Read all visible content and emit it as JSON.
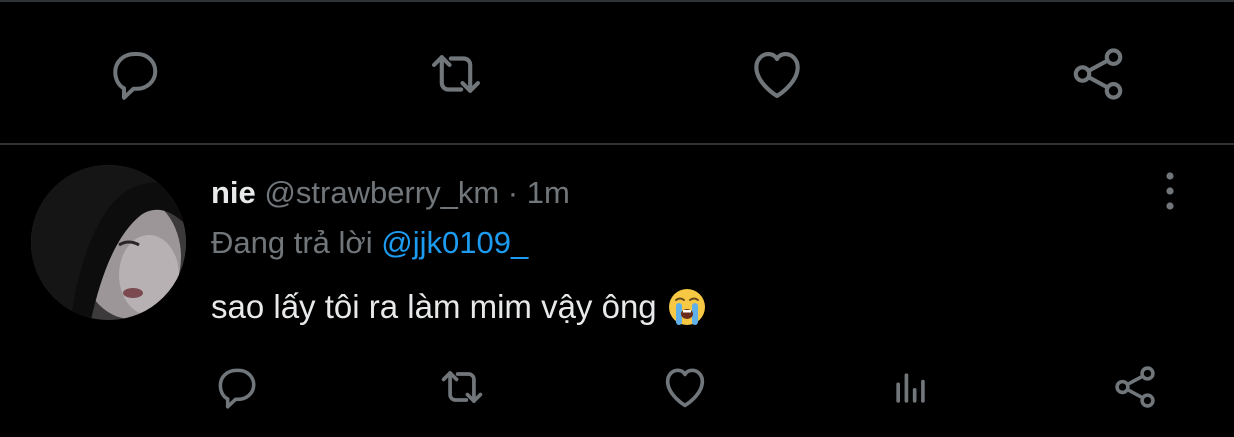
{
  "colors": {
    "background": "#000000",
    "divider": "#2f3336",
    "icon": "#71767b",
    "secondary_text": "#71767b",
    "primary_text": "#e7e9ea",
    "mention": "#1d9bf0"
  },
  "top_action_bar": {
    "icons": [
      "reply-icon",
      "retweet-icon",
      "like-icon",
      "share-icon"
    ]
  },
  "tweet": {
    "display_name": "nie",
    "handle": "@strawberry_km",
    "separator": "·",
    "time": "1m",
    "reply_prefix": "Đang trả lời",
    "reply_mention": "@jjk0109_",
    "text": "sao lấy tôi ra làm mim vậy ông",
    "emoji": "loudly-crying-face-emoji",
    "more_icon": "more-vertical-icon",
    "action_icons": [
      "reply-icon",
      "retweet-icon",
      "like-icon",
      "analytics-icon",
      "share-icon"
    ]
  }
}
